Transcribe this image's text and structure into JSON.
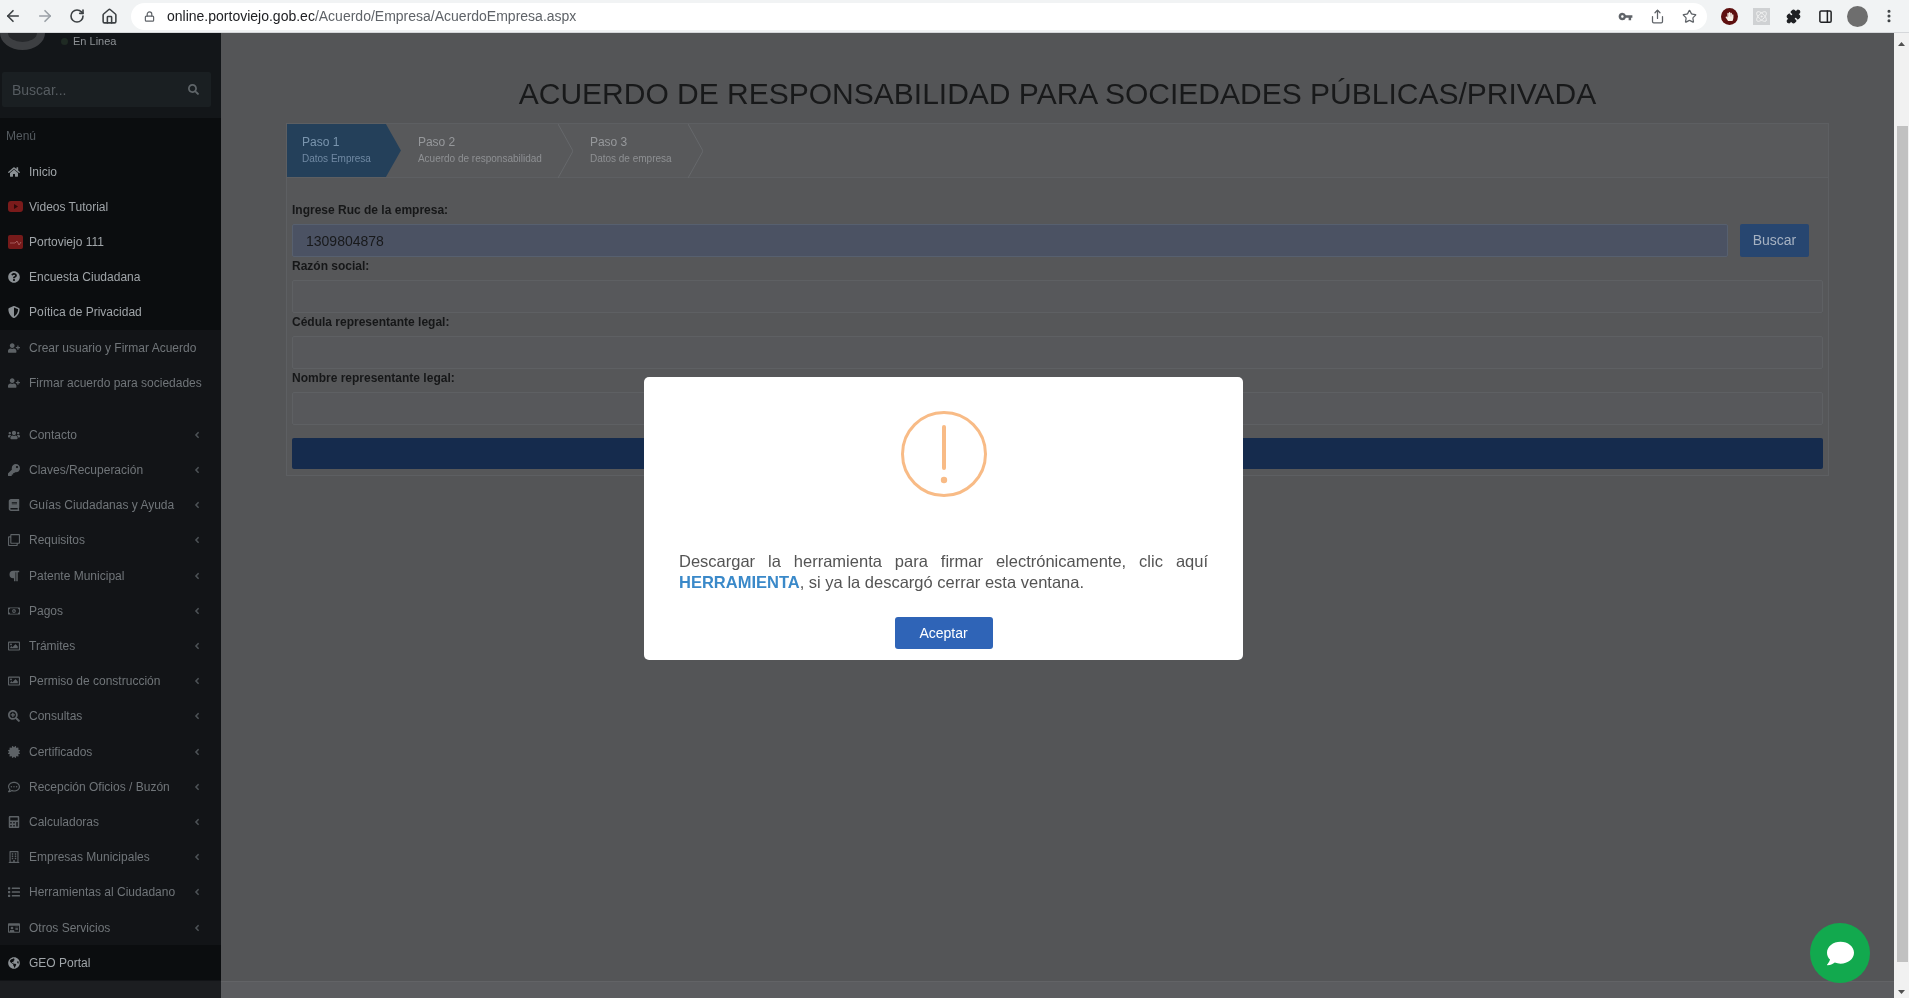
{
  "browser": {
    "url_host": "online.portoviejo.gob.ec",
    "url_path": "/Acuerdo/Empresa/AcuerdoEmpresa.aspx"
  },
  "sidebar": {
    "user_status": "En Linea",
    "search": {
      "placeholder": "Buscar..."
    },
    "menu_header": "Menú",
    "groups": [
      {
        "items": [
          {
            "label": "Inicio",
            "highlighted": true,
            "expandable": false
          },
          {
            "label": "Videos Tutorial",
            "highlighted": true,
            "expandable": false
          },
          {
            "label": "Portoviejo 111",
            "highlighted": true,
            "expandable": false
          },
          {
            "label": "Encuesta Ciudadana",
            "highlighted": true,
            "expandable": false
          },
          {
            "label": "Poítica de Privacidad",
            "highlighted": true,
            "expandable": false
          },
          {
            "label": "Crear usuario y Firmar Acuerdo",
            "highlighted": false,
            "expandable": false
          },
          {
            "label": "Firmar acuerdo para sociedades",
            "highlighted": false,
            "expandable": false
          }
        ]
      },
      {
        "items": [
          {
            "label": "Contacto",
            "highlighted": false,
            "expandable": true
          },
          {
            "label": "Claves/Recuperación",
            "highlighted": false,
            "expandable": true
          },
          {
            "label": "Guías Ciudadanas y Ayuda",
            "highlighted": false,
            "expandable": true
          },
          {
            "label": "Requisitos",
            "highlighted": false,
            "expandable": true
          },
          {
            "label": "Patente Municipal",
            "highlighted": false,
            "expandable": true
          },
          {
            "label": "Pagos",
            "highlighted": false,
            "expandable": true
          },
          {
            "label": "Trámites",
            "highlighted": false,
            "expandable": true
          },
          {
            "label": "Permiso de construcción",
            "highlighted": false,
            "expandable": true
          },
          {
            "label": "Consultas",
            "highlighted": false,
            "expandable": true
          },
          {
            "label": "Certificados",
            "highlighted": false,
            "expandable": true
          },
          {
            "label": "Recepción Oficios / Buzón",
            "highlighted": false,
            "expandable": true
          },
          {
            "label": "Calculadoras",
            "highlighted": false,
            "expandable": true
          },
          {
            "label": "Empresas Municipales",
            "highlighted": false,
            "expandable": true
          },
          {
            "label": "Herramientas al Ciudadano",
            "highlighted": false,
            "expandable": true
          },
          {
            "label": "Otros Servicios",
            "highlighted": false,
            "expandable": true
          },
          {
            "label": "GEO Portal",
            "highlighted": true,
            "expandable": false
          }
        ]
      }
    ]
  },
  "page": {
    "title": "ACUERDO DE RESPONSABILIDAD PARA SOCIEDADES PÚBLICAS/PRIVADA",
    "steps": [
      {
        "label": "Paso 1",
        "sublabel": "Datos Empresa",
        "selected": true
      },
      {
        "label": "Paso 2",
        "sublabel": "Acuerdo de responsabilidad",
        "selected": false
      },
      {
        "label": "Paso 3",
        "sublabel": "Datos de empresa",
        "selected": false
      }
    ],
    "fields": [
      {
        "label": "Ingrese Ruc de la empresa:",
        "value": "1309804878",
        "autofilled": true,
        "button": "Buscar"
      },
      {
        "label": "Razón social:",
        "autofilled": false
      },
      {
        "label": "Cédula representante legal:",
        "autofilled": false
      },
      {
        "label": "Nombre representante legal:",
        "autofilled": false
      }
    ]
  },
  "dialog": {
    "message_before": "Descargar la herramienta para firmar electrónicamente, clic aquí ",
    "link": "HERRAMIENTA",
    "message_after": ", si ya la descargó cerrar esta ventana.",
    "button": "Aceptar"
  }
}
